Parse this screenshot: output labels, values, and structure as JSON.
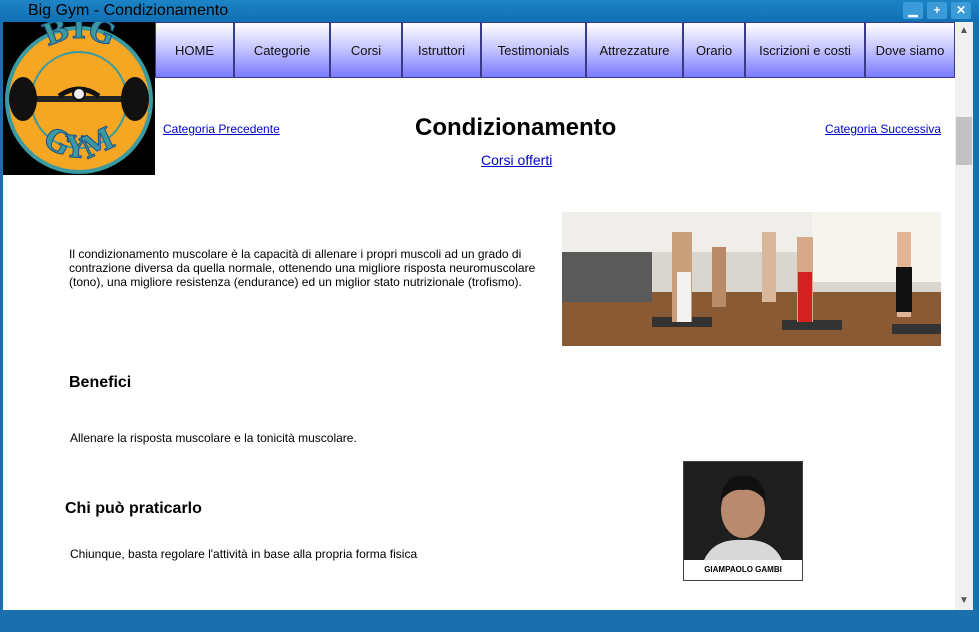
{
  "window": {
    "title": "Big Gym - Condizionamento",
    "minimize_glyph": "▁",
    "maximize_glyph": "+",
    "close_glyph": "✕"
  },
  "logo": {
    "top_text": "BIG",
    "bottom_text": "GYM"
  },
  "nav": {
    "items": [
      {
        "label": "HOME"
      },
      {
        "label": "Categorie"
      },
      {
        "label": "Corsi"
      },
      {
        "label": "Istruttori"
      },
      {
        "label": "Testimonials"
      },
      {
        "label": "Attrezzature"
      },
      {
        "label": "Orario"
      },
      {
        "label": "Iscrizioni e costi"
      },
      {
        "label": "Dove siamo"
      }
    ]
  },
  "header": {
    "prev_link": "Categoria Precedente",
    "next_link": "Categoria Successiva",
    "title": "Condizionamento",
    "sub_link": "Corsi offerti"
  },
  "content": {
    "intro": "Il condizionamento muscolare è la capacità di allenare i propri muscoli ad un grado di contrazione diversa da quella normale, ottenendo una migliore risposta neuromuscolare (tono), una migliore resistenza (endurance) ed un miglior stato nutrizionale (trofismo).",
    "benefici_heading": "Benefici",
    "benefici_text": "Allenare la risposta muscolare e la tonicità muscolare.",
    "chi_heading": "Chi può praticarlo",
    "chi_text": "Chiunque, basta regolare l'attività in base alla propria forma fisica"
  },
  "instructor": {
    "caption": "GIAMPAOLO GAMBI"
  },
  "colors": {
    "frame": "#1a6fae",
    "nav_gradient_bottom": "#7a7aff",
    "link": "#0000cc",
    "logo_orange": "#f5a623",
    "logo_teal": "#3a9aa0"
  }
}
